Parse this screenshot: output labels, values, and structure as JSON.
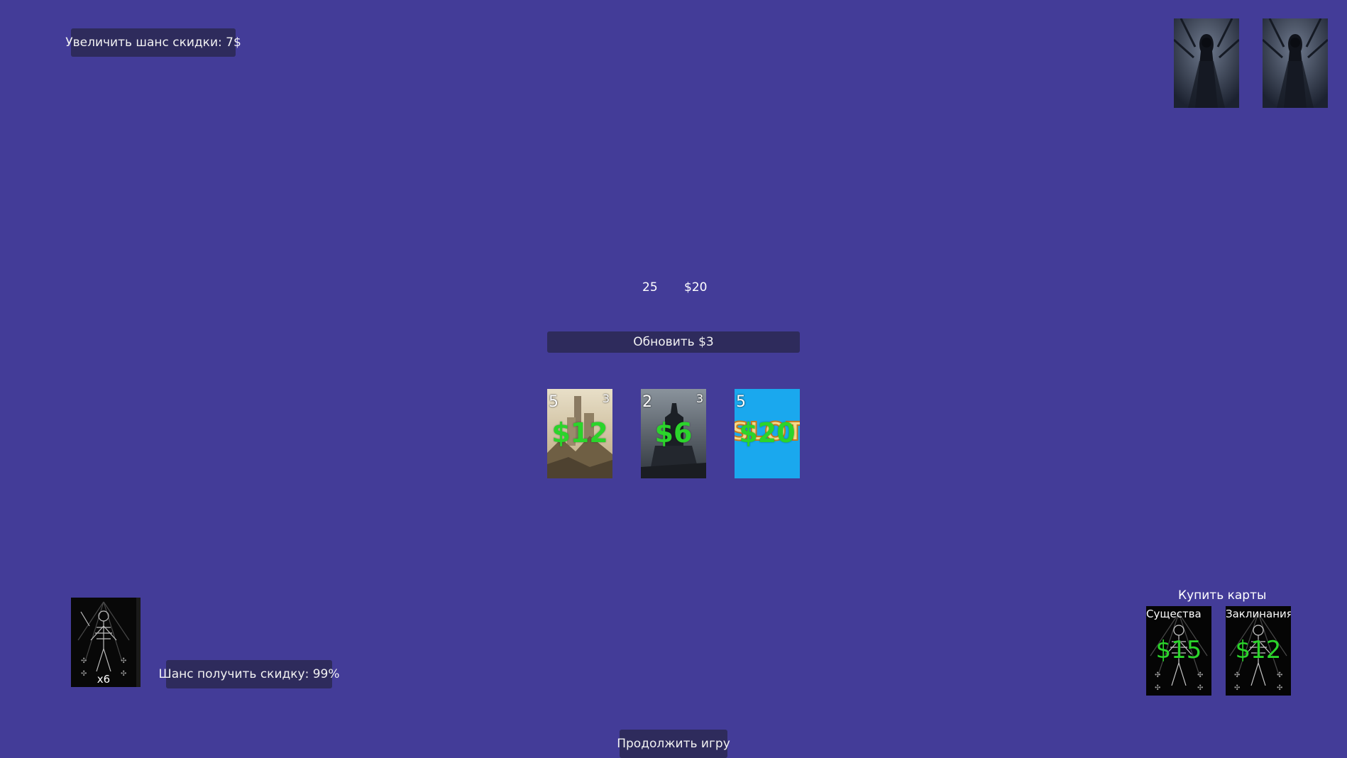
{
  "top": {
    "discount_upgrade_label": "Увеличить шанс скидки: 7$"
  },
  "stats": {
    "count": "25",
    "money": "$20"
  },
  "shop": {
    "refresh_label": "Обновить $3",
    "cards": [
      {
        "top_left": "5",
        "top_right": "3",
        "price": "$12",
        "art": "castle-art"
      },
      {
        "top_left": "2",
        "top_right": "3",
        "price": "$6",
        "art": "knight-art"
      },
      {
        "top_left": "5",
        "top_right": "",
        "price": "$20",
        "art": "slot-art",
        "art_text": "SLOT"
      }
    ]
  },
  "deck": {
    "count_label": "x6"
  },
  "discount_chance_label": "Шанс получить скидку: 99%",
  "buy_cards": {
    "title": "Купить карты",
    "packs": [
      {
        "name": "Существа",
        "price": "$15"
      },
      {
        "name": "Заклинания",
        "price": "$12"
      }
    ]
  },
  "continue_label": "Продолжить игру",
  "colors": {
    "background": "#433c98",
    "button_bg": "#2e2b5c",
    "price_green": "#2bd42b"
  }
}
